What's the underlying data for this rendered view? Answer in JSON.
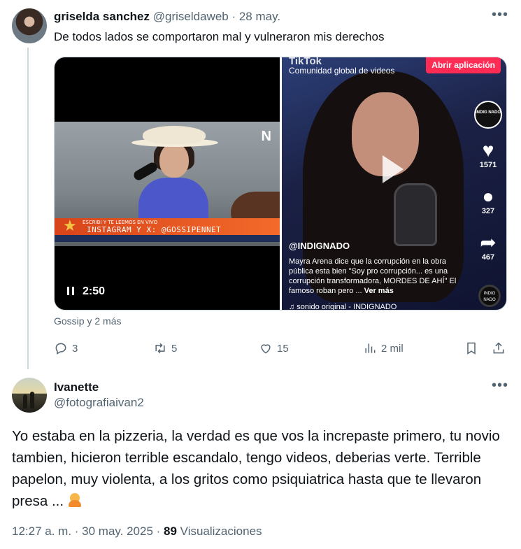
{
  "tweet": {
    "author_name": "griselda sanchez",
    "handle": "@griseldaweb",
    "separator": " · ",
    "date": "28 may.",
    "text": "De todos lados se comportaron mal y vulneraron mis derechos",
    "media": {
      "left_video": {
        "duration": "2:50",
        "overlay_small": "ESCRIBI Y TE LEEMOS EN VIVO",
        "overlay_main": "INSTAGRAM Y X: @GOSSIPENNET",
        "channel_logo": "N"
      },
      "right_video": {
        "tiktok_brand": "TikTok",
        "tiktok_tagline": "Comunidad global de videos",
        "open_app": "Abrir aplicación",
        "badge_text": "INDIG NADO",
        "likes": "1571",
        "comments": "327",
        "shares": "467",
        "username": "@INDIGNADO",
        "description": "Mayra Arena dice que la corrupción en la obra pública esta bien \"Soy pro corrupción... es una corrupción transformadora, MORDES DE AHÍ\" El famoso roban pero ...",
        "see_more": "Ver más",
        "sound": "♫ sonido original - INDIGNADO",
        "disc_text": "INDIG NADO"
      }
    },
    "source_label": "Gossip y 2 más",
    "actions": {
      "replies": "3",
      "reposts": "5",
      "likes": "15",
      "views": "2 mil"
    }
  },
  "reply": {
    "author_name": "Ivanette",
    "handle": "@fotografiaivan2",
    "text": "Yo estaba en la pizzeria, la verdad es que vos la increpaste primero, tu novio tambien, hicieron terrible escandalo, tengo videos, deberias verte. Terrible papelon, muy violenta, a los gritos como psiquiatrica hasta que te llevaron presa ...",
    "timestamp": "12:27 a. m. · 30 may. 2025 · ",
    "views_count": "89",
    "views_label": " Visualizaciones"
  },
  "icons": {
    "more": "more-horizontal-icon",
    "reply": "reply-icon",
    "repost": "repost-icon",
    "like": "heart-icon",
    "views": "views-chart-icon",
    "bookmark": "bookmark-icon",
    "share": "share-icon"
  }
}
